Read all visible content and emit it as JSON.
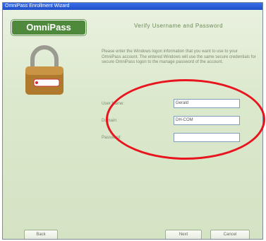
{
  "window": {
    "title": "OmniPass Enrollment Wizard"
  },
  "logo": {
    "text": "OmniPass"
  },
  "header": {
    "title": "Verify Username and Password"
  },
  "instructions": {
    "text": "Please enter the Windows logon information that you want to use to your OmniPass account. The entered Windows will use the same secure credentials for secure OmniPass logon to the manage password of the account."
  },
  "form": {
    "username": {
      "label": "User Name:",
      "value": "Gerald"
    },
    "domain": {
      "label": "Domain:",
      "value": "DH-COM"
    },
    "password": {
      "label": "Password:",
      "value": ""
    }
  },
  "buttons": {
    "back": "Back",
    "next": "Next",
    "cancel": "Cancel"
  },
  "colors": {
    "highlight": "#e8141e",
    "logo_bg": "#4f8a3c",
    "title_bar": "#2a5edb"
  },
  "icons": {
    "lock": "padlock-icon"
  }
}
